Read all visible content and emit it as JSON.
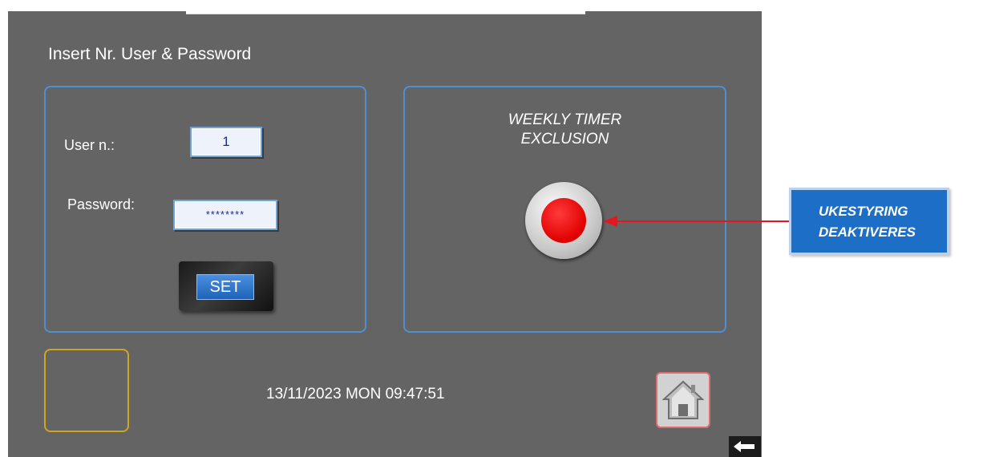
{
  "screen": {
    "title": "Insert Nr. User & Password"
  },
  "login": {
    "user_label": "User n.:",
    "user_value": "1",
    "password_label": "Password:",
    "password_value": "********",
    "set_label": "SET"
  },
  "timer": {
    "title_line1": "WEEKLY TIMER",
    "title_line2": "EXCLUSION",
    "state_color": "#e00000"
  },
  "status": {
    "datetime": "13/11/2023 MON 09:47:51"
  },
  "icons": {
    "home": "home-icon",
    "back": "back-arrow-icon"
  },
  "annotation": {
    "line1": "UKESTYRING",
    "line2": "DEAKTIVERES",
    "box_color": "#1c6ec6",
    "arrow_color": "#e8141e"
  }
}
